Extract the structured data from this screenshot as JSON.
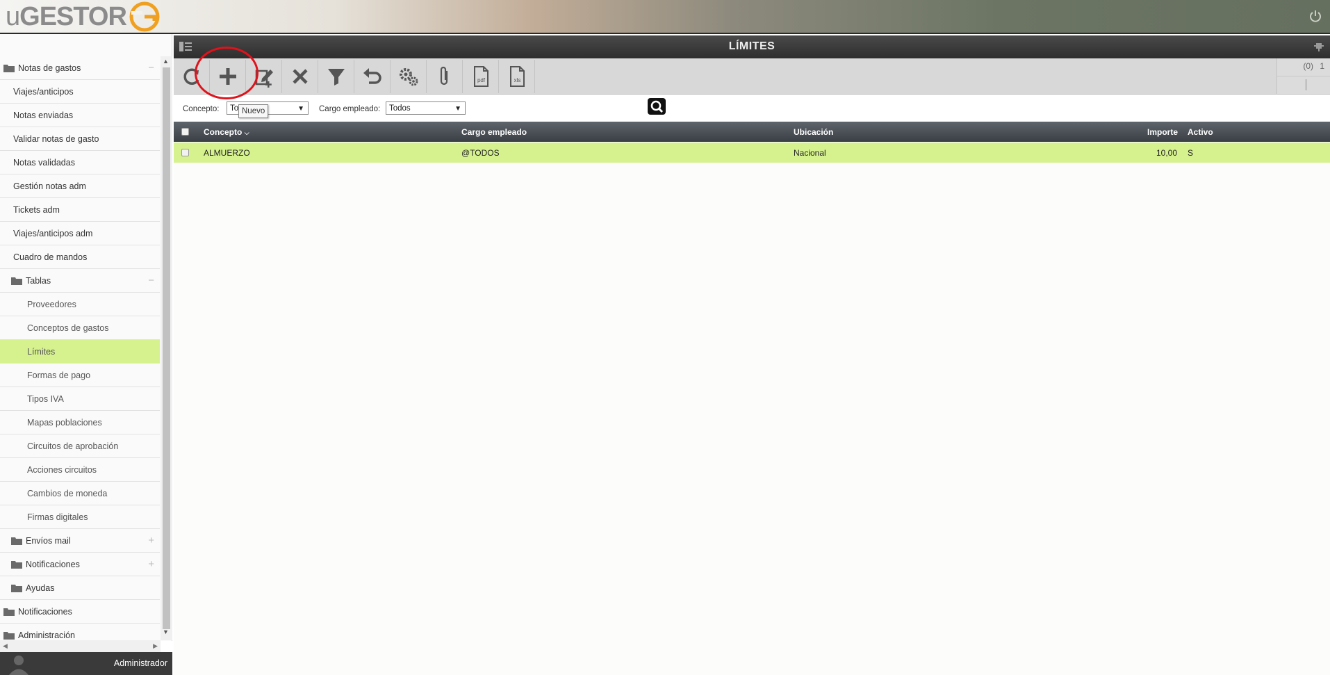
{
  "brand": {
    "logo_u": "u",
    "logo_gestor": "GESTOR"
  },
  "sidebar": {
    "items": [
      {
        "label": "Notas de gastos",
        "level": 0,
        "folder": true,
        "toggle": "−"
      },
      {
        "label": "Viajes/anticipos",
        "level": 1
      },
      {
        "label": "Notas enviadas",
        "level": 1
      },
      {
        "label": "Validar notas de gasto",
        "level": 1
      },
      {
        "label": "Notas validadas",
        "level": 1
      },
      {
        "label": "Gestión notas adm",
        "level": 1
      },
      {
        "label": "Tickets adm",
        "level": 1
      },
      {
        "label": "Viajes/anticipos adm",
        "level": 1
      },
      {
        "label": "Cuadro de mandos",
        "level": 1
      },
      {
        "label": "Tablas",
        "level": 1,
        "folder": true,
        "toggle": "−"
      },
      {
        "label": "Proveedores",
        "level": 2
      },
      {
        "label": "Conceptos de gastos",
        "level": 2
      },
      {
        "label": "Límites",
        "level": 2,
        "active": true
      },
      {
        "label": "Formas de pago",
        "level": 2
      },
      {
        "label": "Tipos IVA",
        "level": 2
      },
      {
        "label": "Mapas poblaciones",
        "level": 2
      },
      {
        "label": "Circuitos de aprobación",
        "level": 2
      },
      {
        "label": "Acciones circuitos",
        "level": 2
      },
      {
        "label": "Cambios de moneda",
        "level": 2
      },
      {
        "label": "Firmas digitales",
        "level": 2
      },
      {
        "label": "Envíos mail",
        "level": 1,
        "folder": true,
        "toggle": "+"
      },
      {
        "label": "Notificaciones",
        "level": 1,
        "folder": true,
        "toggle": "+"
      },
      {
        "label": "Ayudas",
        "level": 1,
        "folder": true
      },
      {
        "label": "Notificaciones",
        "level": 0,
        "folder": true
      },
      {
        "label": "Administración",
        "level": 0,
        "folder": true
      }
    ],
    "user": "Administrador"
  },
  "main": {
    "title": "LÍMITES",
    "toolbar": [
      {
        "name": "refresh-button",
        "icon": "refresh-icon"
      },
      {
        "name": "new-button",
        "icon": "plus-icon"
      },
      {
        "name": "edit-button",
        "icon": "edit-icon"
      },
      {
        "name": "delete-button",
        "icon": "close-icon"
      },
      {
        "name": "filter-button",
        "icon": "filter-icon"
      },
      {
        "name": "undo-button",
        "icon": "undo-icon"
      },
      {
        "name": "settings-button",
        "icon": "gears-icon"
      },
      {
        "name": "attach-button",
        "icon": "paperclip-icon"
      },
      {
        "name": "pdf-button",
        "icon": "pdf-icon",
        "text": "pdf"
      },
      {
        "name": "xls-button",
        "icon": "xls-icon",
        "text": "xls"
      }
    ],
    "pager": {
      "count": "(0)",
      "page": "1"
    },
    "tooltip": "Nuevo",
    "filters": {
      "concepto_label": "Concepto:",
      "concepto_value": "To",
      "cargo_label": "Cargo empleado:",
      "cargo_value": "Todos"
    },
    "table": {
      "columns": [
        "Concepto",
        "Cargo empleado",
        "Ubicación",
        "Importe",
        "Activo"
      ],
      "rows": [
        {
          "concepto": "ALMUERZO",
          "cargo": "@TODOS",
          "ubicacion": "Nacional",
          "importe": "10,00",
          "activo": "S"
        }
      ]
    }
  },
  "colors": {
    "active": "#d6f28f",
    "annotation": "#e0121b",
    "logo_orange": "#f0a020"
  }
}
